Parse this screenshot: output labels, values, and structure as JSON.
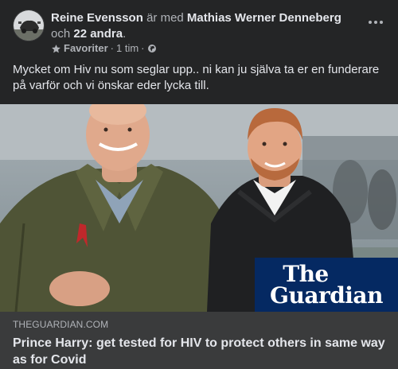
{
  "post": {
    "author": "Reine Evensson",
    "with_text": "är med",
    "tagged_person": "Mathias Werner Denneberg",
    "and_text": "och",
    "others": "22 andra",
    "period": ".",
    "audience": "Favoriter",
    "separator": "·",
    "time": "1 tim",
    "separator2": "·",
    "text": "Mycket om Hiv nu som seglar upp.. ni kan ju själva ta er en funderare på varför och vi önskar eder lycka till."
  },
  "icons": {
    "avatar": "avatar",
    "star": "star-icon",
    "globe": "globe-icon",
    "more": "more-options-icon"
  },
  "link": {
    "logo_line1": "The",
    "logo_line2": "Guardian",
    "domain": "THEGUARDIAN.COM",
    "title": "Prince Harry: get tested for HIV to protect others in same way as for Covid"
  },
  "colors": {
    "background": "#242526",
    "card": "#3a3b3c",
    "text_primary": "#e4e6eb",
    "text_secondary": "#b0b3b8",
    "guardian_blue": "#052962"
  }
}
